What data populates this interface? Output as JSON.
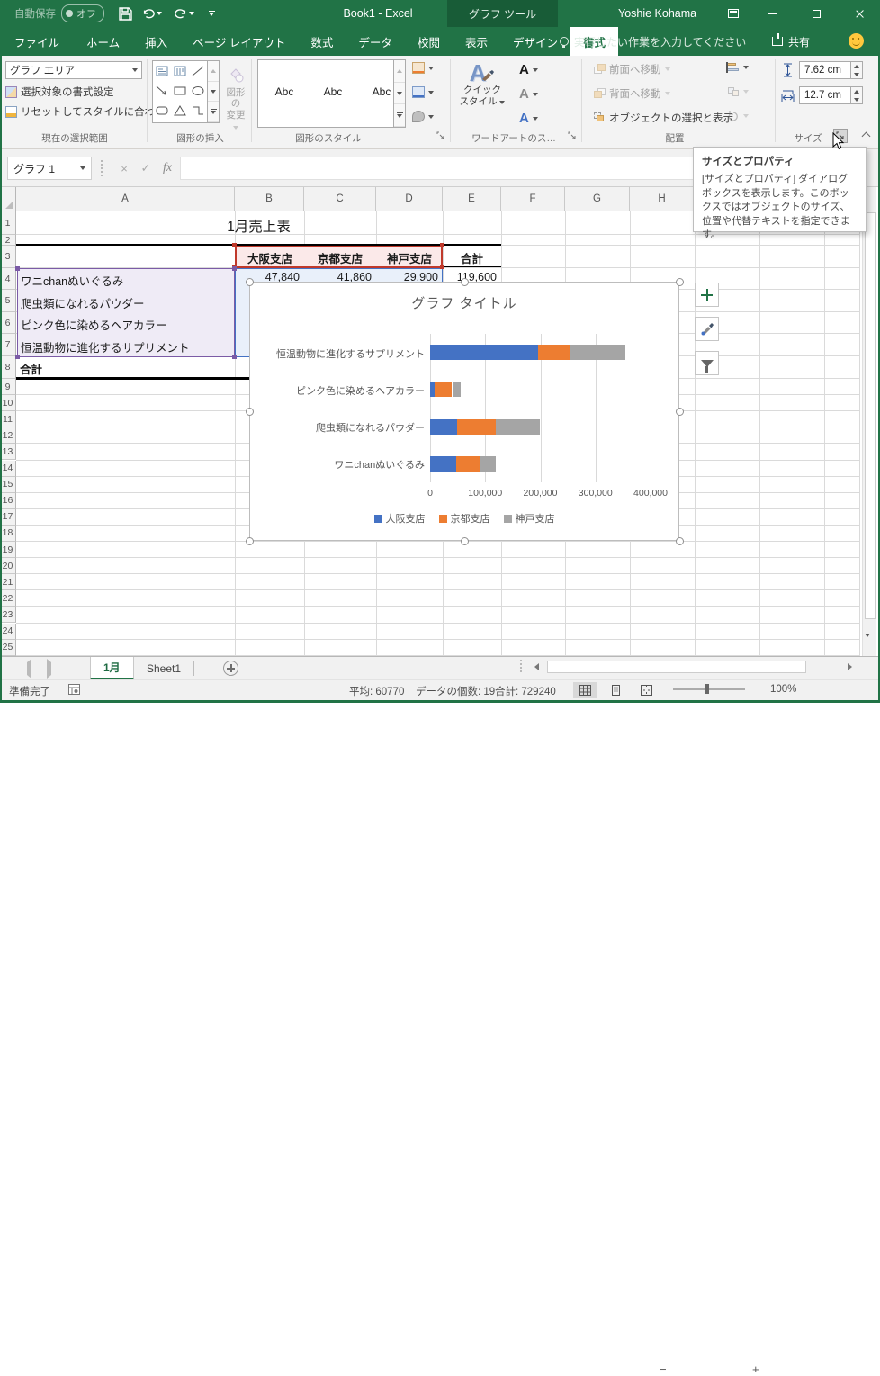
{
  "titlebar": {
    "autosave_label": "自動保存",
    "autosave_state": "オフ",
    "workbook_title": "Book1  -  Excel",
    "context_header": "グラフ ツール",
    "user_name": "Yoshie Kohama"
  },
  "ribbon_tabs": {
    "file": "ファイル",
    "main": [
      "ホーム",
      "挿入",
      "ページ レイアウト",
      "数式",
      "データ",
      "校閲",
      "表示"
    ],
    "contextual": [
      "デザイン",
      "書式"
    ],
    "active": "書式",
    "tell_me": "実行したい作業を入力してください",
    "share": "共有"
  },
  "ribbon": {
    "selection_group": {
      "combo_value": "グラフ エリア",
      "btn_format": "選択対象の書式設定",
      "btn_reset": "リセットしてスタイルに合わせる",
      "label": "現在の選択範囲"
    },
    "shapes_group": {
      "change_shape_line1": "図形の",
      "change_shape_line2": "変更",
      "label": "図形の挿入"
    },
    "shape_styles_group": {
      "sample": "Abc",
      "style_borders": [
        "#2E2E2E",
        "#4472C4",
        "#ED7D31"
      ],
      "label": "図形のスタイル"
    },
    "wordart_group": {
      "glyph": "A",
      "quick_line1": "クイック",
      "quick_line2": "スタイル",
      "label": "ワードアートのス…"
    },
    "arrange_group": {
      "bring_front": "前面へ移動",
      "send_back": "背面へ移動",
      "selection_pane": "オブジェクトの選択と表示",
      "label": "配置"
    },
    "size_group": {
      "height_value": "7.62 cm",
      "width_value": "12.7 cm",
      "label": "サイズ"
    }
  },
  "tooltip": {
    "title": "サイズとプロパティ",
    "body": "[サイズとプロパティ] ダイアログ ボックスを表示します。このボックスではオブジェクトのサイズ、位置や代替テキストを指定できます。"
  },
  "formula_bar": {
    "name_box": "グラフ 1",
    "fx": "fx"
  },
  "grid": {
    "columns": [
      "A",
      "B",
      "C",
      "D",
      "E",
      "F",
      "G",
      "H"
    ],
    "row_count": 25
  },
  "cells": {
    "title": "1月売上表",
    "headers": [
      "大阪支店",
      "京都支店",
      "神戸支店"
    ],
    "total_header": "合計",
    "row4": {
      "label": "ワニchanぬいぐるみ",
      "values": [
        "47,840",
        "41,860",
        "29,900"
      ],
      "total": "119,600"
    },
    "row5_label": "爬虫類になれるパウダー",
    "row6_label": "ピンク色に染めるヘアカラー",
    "row7_label": "恒温動物に進化するサプリメント",
    "row8_label": "合計"
  },
  "chart_data": {
    "type": "bar",
    "orientation": "horizontal-stacked",
    "title": "グラフ タイトル",
    "categories_top_to_bottom": [
      "恒温動物に進化するサプリメント",
      "ピンク色に染めるヘアカラー",
      "爬虫類になれるパウダー",
      "ワニchanぬいぐるみ"
    ],
    "series": [
      {
        "name": "大阪支店",
        "color": "#4472C4",
        "values": [
          196000,
          8000,
          48640,
          47840
        ]
      },
      {
        "name": "京都支店",
        "color": "#ED7D31",
        "values": [
          57000,
          32000,
          70000,
          41860
        ]
      },
      {
        "name": "神戸支店",
        "color": "#A5A5A5",
        "values": [
          102000,
          15000,
          81000,
          29900
        ]
      }
    ],
    "x_ticks": [
      "0",
      "100,000",
      "200,000",
      "300,000",
      "400,000"
    ],
    "xlim": [
      0,
      400000
    ],
    "legend_position": "bottom",
    "grid": true
  },
  "sheet_tabs": {
    "tabs": [
      "1月",
      "Sheet1"
    ],
    "active": "1月"
  },
  "status_bar": {
    "ready": "準備完了",
    "average": "平均: 60770",
    "count": "データの個数: 19",
    "sum": "合計: 729240",
    "zoom": "100%"
  },
  "colors": {
    "excel_green": "#217346",
    "context_green": "#185C37",
    "series_blue": "#4472C4",
    "series_orange": "#ED7D31",
    "series_gray": "#A5A5A5",
    "range_red": "#C0392B",
    "range_purple": "#7B5BA6",
    "range_blue": "#4472C4"
  }
}
